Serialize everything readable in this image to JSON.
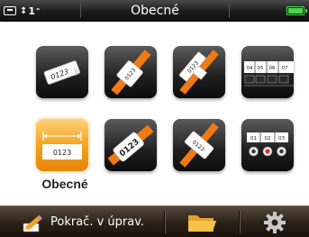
{
  "status_bar": {
    "label_icon": "label-icon",
    "tape_width_arrows": "↕",
    "tape_width_value": "1",
    "tape_width_unit": "\"",
    "title": "Obecné",
    "battery_icon": "battery-icon",
    "battery_color": "#4ed34e"
  },
  "grid": {
    "accent_color": "#f5a31f",
    "selected_label": "Obecné",
    "tiles": [
      {
        "icon": "general-label-icon",
        "text": "0123"
      },
      {
        "icon": "wire-wrap-label-icon",
        "text": "0123"
      },
      {
        "icon": "cable-flag-label-icon",
        "text": "0123"
      },
      {
        "icon": "patch-panel-label-icon",
        "texts": [
          "04",
          "05",
          "06",
          "07"
        ]
      },
      {
        "icon": "fixed-length-label-icon",
        "text": "0123",
        "selected": true
      },
      {
        "icon": "heat-shrink-tube-icon",
        "text": "0123"
      },
      {
        "icon": "cable-wrap-label-icon",
        "text": "0123"
      },
      {
        "icon": "terminal-block-label-icon",
        "texts": [
          "01",
          "02",
          "03"
        ]
      }
    ]
  },
  "bottom_bar": {
    "continue_label": "Pokrač. v úprav.",
    "continue_icon": "pencil-edit-icon",
    "folder_icon": "folder-icon",
    "settings_icon": "gear-icon"
  }
}
